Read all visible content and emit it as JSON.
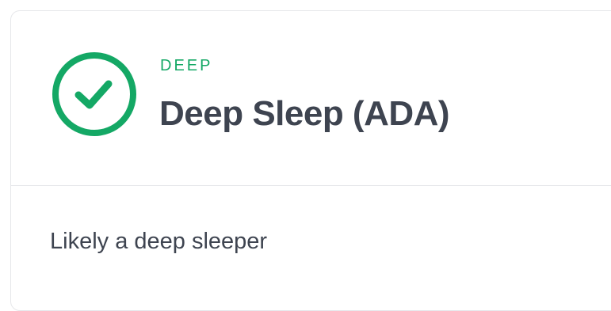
{
  "result": {
    "category": "DEEP",
    "title": "Deep Sleep (ADA)",
    "description": "Likely a deep sleeper",
    "status_icon": "check-circle-icon",
    "accent_color": "#14a865",
    "text_color": "#3e4450"
  }
}
